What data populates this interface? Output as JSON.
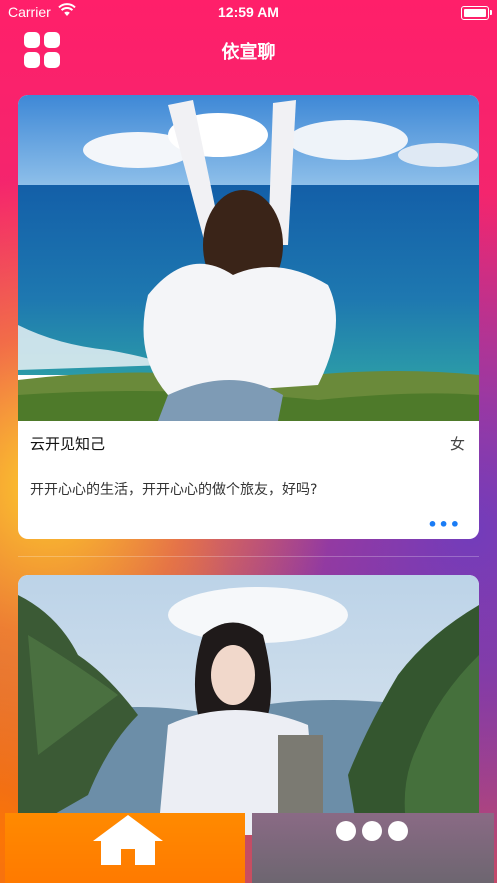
{
  "status_bar": {
    "carrier": "Carrier",
    "time": "12:59 AM"
  },
  "nav": {
    "title": "依宣聊",
    "menu_icon": "grid-icon"
  },
  "cards": [
    {
      "name": "云开见知己",
      "gender": "女",
      "description": "开开心心的生活，开开心心的做个旅友，好吗?",
      "more": "•••"
    },
    {
      "name": "",
      "gender": "",
      "description": ""
    }
  ],
  "tabbar": {
    "home_icon": "home-icon",
    "more_icon": "more-dots-icon",
    "home_color": "#ff7f00",
    "more_color": "#77697a"
  }
}
